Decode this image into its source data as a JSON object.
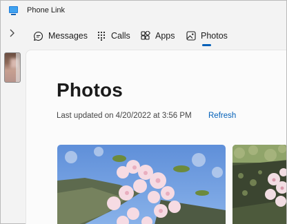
{
  "window": {
    "title": "Phone Link",
    "icon": "phone-link-app-icon"
  },
  "nav": {
    "expand_icon": "chevron-right-icon",
    "tabs": [
      {
        "label": "Messages",
        "icon": "chat-bubble-icon"
      },
      {
        "label": "Calls",
        "icon": "dialpad-icon"
      },
      {
        "label": "Apps",
        "icon": "apps-grid-icon"
      },
      {
        "label": "Photos",
        "icon": "photo-icon",
        "selected": true
      }
    ]
  },
  "rail": {
    "items": [
      {
        "type": "phone-wallpaper-thumbnail"
      }
    ]
  },
  "main": {
    "title": "Photos",
    "updated_text": "Last updated on 4/20/2022 at 3:56 PM",
    "refresh_label": "Refresh",
    "photos": [
      {
        "subject": "cherry-blossom-photo"
      },
      {
        "subject": "blossom-on-mossy-branch-photo"
      }
    ]
  },
  "colors": {
    "accent": "#005fb8",
    "background": "#f3f3f3",
    "panel": "#fbfbfb"
  }
}
